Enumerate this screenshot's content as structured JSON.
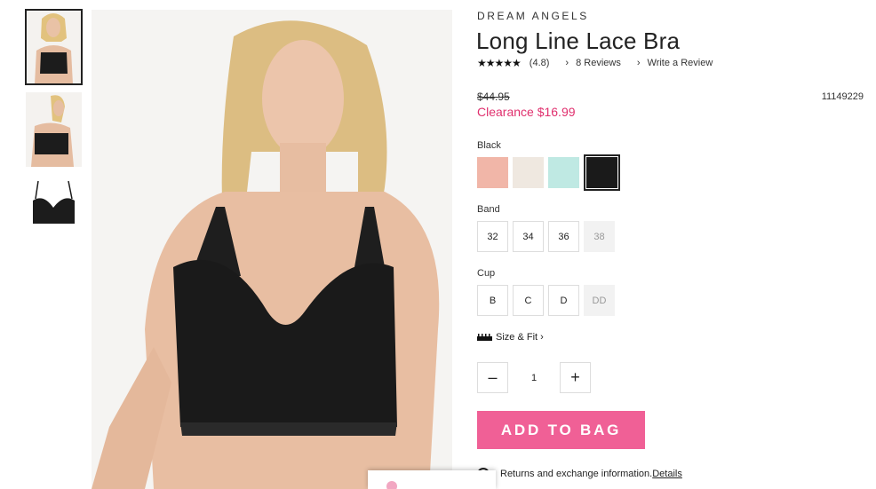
{
  "product": {
    "brand": "DREAM ANGELS",
    "title": "Long Line Lace Bra",
    "stars": "★★★★★",
    "rating": "(4.8)",
    "reviews_label": "8 Reviews",
    "write_review_label": "Write a Review",
    "original_price": "$44.95",
    "sale_price": "Clearance $16.99",
    "sku": "11149229"
  },
  "color": {
    "label": "Black",
    "swatches": [
      {
        "name": "peach",
        "hex": "#f1b6a8"
      },
      {
        "name": "ivory",
        "hex": "#efe8e0"
      },
      {
        "name": "mint",
        "hex": "#bfe9e3"
      },
      {
        "name": "black",
        "hex": "#1a1a1a"
      }
    ],
    "selected": "black"
  },
  "band": {
    "label": "Band",
    "options": [
      "32",
      "34",
      "36",
      "38"
    ]
  },
  "cup": {
    "label": "Cup",
    "options": [
      "B",
      "C",
      "D",
      "DD"
    ]
  },
  "size_fit_label": "Size & Fit",
  "size_fit_chevron": "›",
  "quantity": {
    "minus": "–",
    "value": "1",
    "plus": "+"
  },
  "add_to_bag_label": "ADD TO BAG",
  "returns": {
    "text": "Returns and exchange information.",
    "link": "Details"
  },
  "colors": {
    "accent_pink": "#f06096",
    "sale_pink": "#e0306e"
  }
}
